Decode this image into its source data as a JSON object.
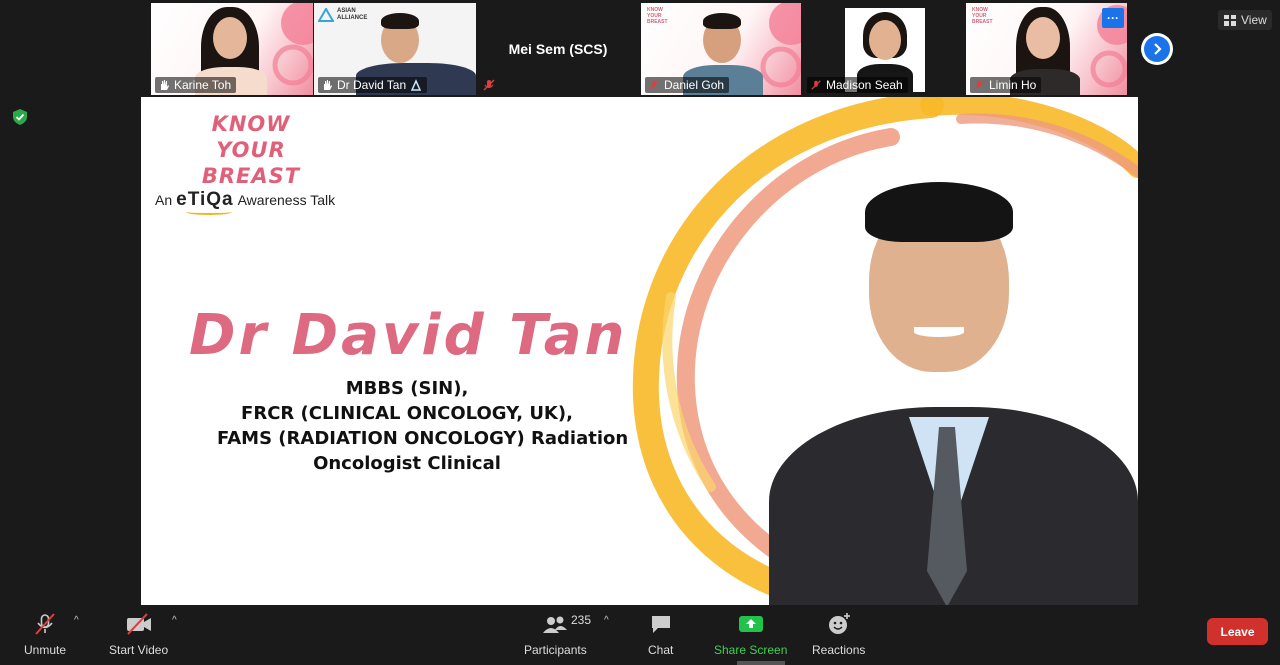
{
  "gallery": {
    "tiles": [
      {
        "name": "Karine Toh"
      },
      {
        "name": "Dr David Tan"
      },
      {
        "name": "Mei Sem (SCS)"
      },
      {
        "name": "Daniel Goh"
      },
      {
        "name": "Madison Seah"
      },
      {
        "name": "Limin Ho"
      }
    ],
    "mini_logo": [
      "KNOW",
      "YOUR",
      "BREAST"
    ],
    "alliance_logo": [
      "ASIAN",
      "ALLIANCE"
    ],
    "view_label": "View",
    "more_label": "···"
  },
  "slide": {
    "kyb": [
      "KNOW",
      "YOUR",
      "BREAST"
    ],
    "awareness_prefix": "An",
    "brand": "eTiQa",
    "awareness_suffix": "Awareness Talk",
    "speaker_name": "Dr David Tan",
    "credentials": [
      "MBBS (SIN),",
      "FRCR (CLINICAL ONCOLOGY, UK),",
      "FAMS (RADIATION ONCOLOGY) Radiation",
      "Oncologist Clinical"
    ]
  },
  "toolbar": {
    "unmute": "Unmute",
    "start_video": "Start Video",
    "participants": "Participants",
    "participant_count": "235",
    "chat": "Chat",
    "share_screen": "Share Screen",
    "reactions": "Reactions",
    "leave": "Leave"
  },
  "colors": {
    "accent_blue": "#1a73e8",
    "share_green": "#3ad353",
    "leave_red": "#d0312d",
    "slide_pink": "#dd6a80",
    "swoosh_yellow": "#f7b928",
    "swoosh_salmon": "#ee9a7e"
  }
}
